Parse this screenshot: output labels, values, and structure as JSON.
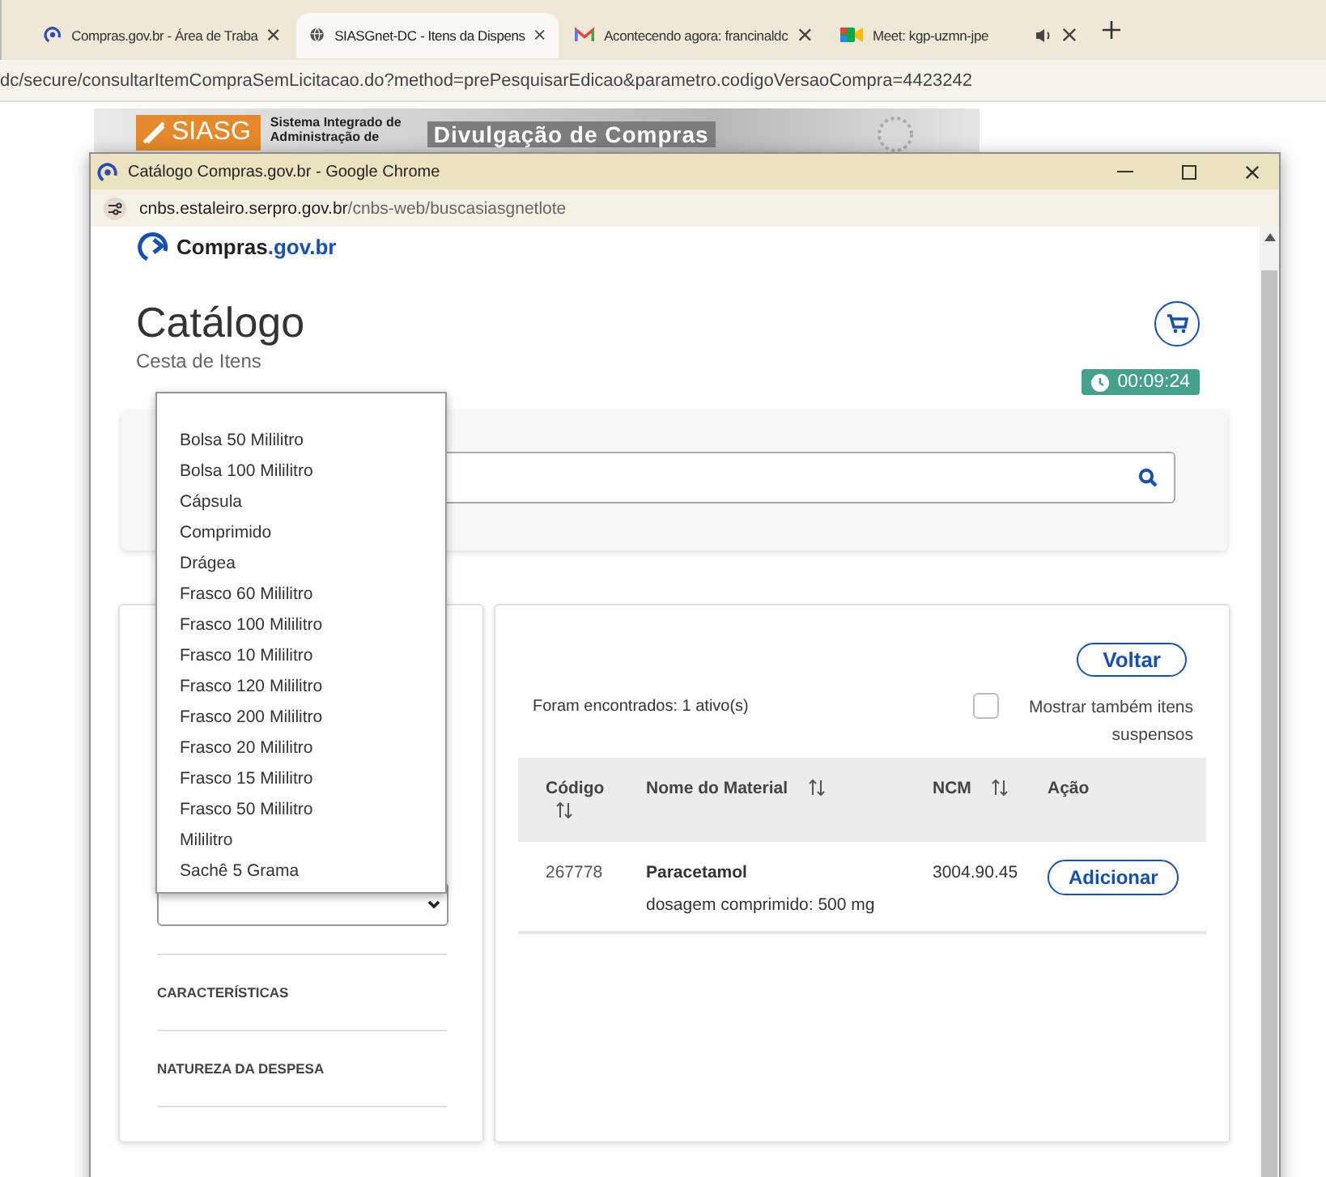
{
  "browser": {
    "tabs": [
      {
        "title": "Compras.gov.br - Área de Traba",
        "kind": "ring",
        "selected": false,
        "audio": false
      },
      {
        "title": "SIASGnet-DC - Itens da Dispens",
        "kind": "globe",
        "selected": true,
        "audio": false
      },
      {
        "title": "Acontecendo agora: francinaldc",
        "kind": "mail",
        "selected": false,
        "audio": false
      },
      {
        "title": "Meet: kgp-uzmn-jpe",
        "kind": "camera",
        "selected": false,
        "audio": true
      }
    ],
    "address": "dc/secure/consultarItemCompraSemLicitacao.do?method=prePesquisarEdicao&parametro.codigoVersaoCompra=4423242"
  },
  "banner": {
    "logo_text": "SIASG",
    "system_lines": [
      "Sistema Integrado de",
      "Administração de"
    ],
    "heading": "Divulgação de Compras"
  },
  "popup": {
    "title": "Catálogo Compras.gov.br - Google Chrome",
    "host": "cnbs.estaleiro.serpro.gov.br",
    "path": "/cnbs-web/buscasiasgnetlote"
  },
  "page": {
    "brand": "Compras",
    "brand_suffix": ".gov.br",
    "title": "Catálogo",
    "subtitle": "Cesta de Itens",
    "timer": "00:09:24"
  },
  "dropdown": {
    "options": [
      {
        "label": "Bolsa 50 Mililitro",
        "selected": false
      },
      {
        "label": "Bolsa 100 Mililitro",
        "selected": false
      },
      {
        "label": "Cápsula",
        "selected": false
      },
      {
        "label": "Comprimido",
        "selected": false
      },
      {
        "label": "Drágea",
        "selected": false
      },
      {
        "label": "Frasco 60 Mililitro",
        "selected": false
      },
      {
        "label": "Frasco 100 Mililitro",
        "selected": false
      },
      {
        "label": "Frasco 10 Mililitro",
        "selected": false
      },
      {
        "label": "Frasco 120 Mililitro",
        "selected": false
      },
      {
        "label": "Frasco 200 Mililitro",
        "selected": false
      },
      {
        "label": "Frasco 20 Mililitro",
        "selected": false
      },
      {
        "label": "Frasco 15 Mililitro",
        "selected": false
      },
      {
        "label": "Frasco 50 Mililitro",
        "selected": false
      },
      {
        "label": "Mililitro",
        "selected": false
      },
      {
        "label": "Sachê 5 Grama",
        "selected": false
      }
    ]
  },
  "filters": [
    "CARACTERÍSTICAS",
    "NATUREZA DA DESPESA"
  ],
  "results": {
    "back_button": "Voltar",
    "count": "Foram encontrados: 1 ativo(s)",
    "show_suspended": {
      "label": "Mostrar também itens suspensos",
      "checked": false
    },
    "table": {
      "columns": [
        {
          "label": "Código",
          "sortable": true
        },
        {
          "label": "Nome do Material",
          "sortable": true
        },
        {
          "label": "NCM",
          "sortable": true
        },
        {
          "label": "Ação",
          "sortable": false
        }
      ],
      "rows": [
        {
          "code": "267778",
          "name": "Paracetamol",
          "description": "dosagem comprimido: 500 mg",
          "ncm": "3004.90.45",
          "action": "Adicionar"
        }
      ]
    }
  }
}
